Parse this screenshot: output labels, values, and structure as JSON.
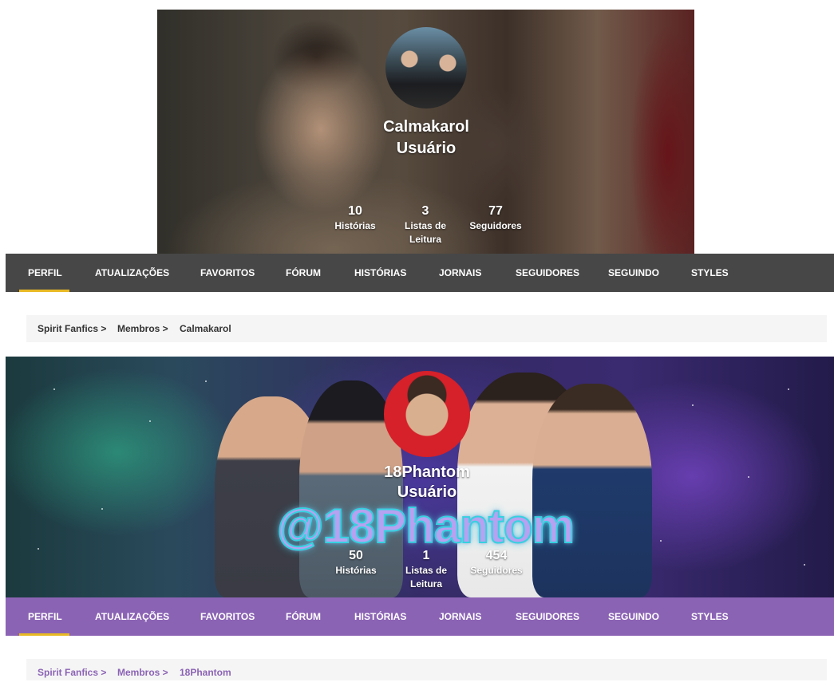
{
  "profile1": {
    "username": "Calmakarol",
    "role": "Usuário",
    "stats": [
      {
        "value": "10",
        "label": "Histórias"
      },
      {
        "value": "3",
        "label": "Listas de Leitura"
      },
      {
        "value": "77",
        "label": "Seguidores"
      }
    ],
    "nav": [
      "PERFIL",
      "ATUALIZAÇÕES",
      "FAVORITOS",
      "FÓRUM",
      "HISTÓRIAS",
      "JORNAIS",
      "SEGUIDORES",
      "SEGUINDO",
      "STYLES"
    ],
    "active_tab": "PERFIL",
    "breadcrumb": [
      "Spirit Fanfics >",
      "Membros >",
      "Calmakarol"
    ],
    "nav_color": "#474747"
  },
  "profile2": {
    "username": "18Phantom",
    "role": "Usuário",
    "banner_text": "@18Phantom",
    "stats": [
      {
        "value": "50",
        "label": "Histórias"
      },
      {
        "value": "1",
        "label": "Listas de Leitura"
      },
      {
        "value": "454",
        "label": "Seguidores"
      }
    ],
    "nav": [
      "PERFIL",
      "ATUALIZAÇÕES",
      "FAVORITOS",
      "FÓRUM",
      "HISTÓRIAS",
      "JORNAIS",
      "SEGUIDORES",
      "SEGUINDO",
      "STYLES"
    ],
    "active_tab": "PERFIL",
    "breadcrumb": [
      "Spirit Fanfics >",
      "Membros >",
      "18Phantom"
    ],
    "nav_color": "#8b63b4"
  },
  "colors": {
    "active_indicator": "#e8b923",
    "breadcrumb_bg": "#f5f5f5"
  }
}
